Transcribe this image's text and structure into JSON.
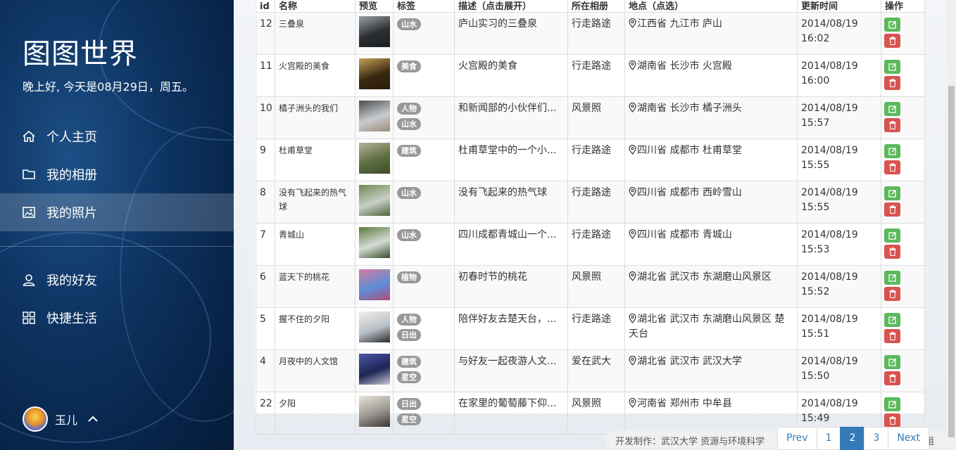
{
  "sidebar": {
    "brand": "图图世界",
    "greeting": "晚上好, 今天是08月29日，周五。",
    "nav": [
      {
        "label": "个人主页",
        "icon": "home-icon"
      },
      {
        "label": "我的相册",
        "icon": "folder-icon"
      },
      {
        "label": "我的照片",
        "icon": "image-icon",
        "active": true
      },
      {
        "label": "我的好友",
        "icon": "user-icon"
      },
      {
        "label": "快捷生活",
        "icon": "grid-icon"
      }
    ],
    "user": {
      "name": "玉儿",
      "icon": "chevron-up-icon"
    }
  },
  "table": {
    "headers": [
      "id",
      "名称",
      "预览",
      "标签",
      "描述（点击展开）",
      "所在相册",
      "地点（点选）",
      "更新时间",
      "操作"
    ],
    "rows": [
      {
        "id": "12",
        "name": "三叠泉",
        "tags": [
          "山水"
        ],
        "desc": "庐山实习的三叠泉",
        "album": "行走路途",
        "location": "江西省 九江市 庐山",
        "date": "2014/08/19",
        "time": "16:02",
        "thumb": [
          "#2b2f33",
          "#9aa0a4",
          "#1a1d20"
        ]
      },
      {
        "id": "11",
        "name": "火宫殿的美食",
        "tags": [
          "美食"
        ],
        "desc": "火宫殿的美食",
        "album": "行走路途",
        "location": "湖南省 长沙市 火宫殿",
        "date": "2014/08/19",
        "time": "16:00",
        "thumb": [
          "#3a2a12",
          "#c9a25a",
          "#2a1c0c"
        ]
      },
      {
        "id": "10",
        "name": "橘子洲头的我们",
        "tags": [
          "人物",
          "山水"
        ],
        "desc": "和新闻部的小伙伴们...",
        "album": "风景照",
        "location": "湖南省 长沙市 橘子洲头",
        "date": "2014/08/19",
        "time": "15:57",
        "thumb": [
          "#c8ccd0",
          "#4b4b4b",
          "#9a8b7c"
        ]
      },
      {
        "id": "9",
        "name": "杜甫草堂",
        "tags": [
          "建筑"
        ],
        "desc": "杜甫草堂中的一个小...",
        "album": "行走路途",
        "location": "四川省 成都市 杜甫草堂",
        "date": "2014/08/19",
        "time": "15:55",
        "thumb": [
          "#5c6e3f",
          "#b7b19a",
          "#3e4a2c"
        ]
      },
      {
        "id": "8",
        "name": "没有飞起来的热气球",
        "tags": [
          "山水"
        ],
        "desc": "没有飞起来的热气球",
        "album": "行走路途",
        "location": "四川省 成都市 西岭雪山",
        "date": "2014/08/19",
        "time": "15:55",
        "thumb": [
          "#c9cfc8",
          "#6e8a4e",
          "#4c6436"
        ]
      },
      {
        "id": "7",
        "name": "青城山",
        "tags": [
          "山水"
        ],
        "desc": "四川成都青城山一个...",
        "album": "行走路途",
        "location": "四川省 成都市 青城山",
        "date": "2014/08/19",
        "time": "15:53",
        "thumb": [
          "#d7dbd6",
          "#5a7a3a",
          "#34502a"
        ]
      },
      {
        "id": "6",
        "name": "蓝天下的桃花",
        "tags": [
          "植物"
        ],
        "desc": "初春时节的桃花",
        "album": "风景照",
        "location": "湖北省 武汉市 东湖磨山风景区",
        "date": "2014/08/19",
        "time": "15:52",
        "thumb": [
          "#5d8fd6",
          "#d47aa0",
          "#b04a78"
        ]
      },
      {
        "id": "5",
        "name": "握不住的夕阳",
        "tags": [
          "人物",
          "日出"
        ],
        "desc": "陪伴好友去楚天台，...",
        "album": "行走路途",
        "location": "湖北省 武汉市 东湖磨山风景区 楚天台",
        "date": "2014/08/19",
        "time": "15:51",
        "thumb": [
          "#b9c0c8",
          "#f2efe6",
          "#2b2b2b"
        ]
      },
      {
        "id": "4",
        "name": "月夜中的人文馆",
        "tags": [
          "建筑",
          "星空"
        ],
        "desc": "与好友一起夜游人文...",
        "album": "爱在武大",
        "location": "湖北省 武汉市 武汉大学",
        "date": "2014/08/19",
        "time": "15:50",
        "thumb": [
          "#1d2454",
          "#4a57a8",
          "#c8c8d8"
        ]
      },
      {
        "id": "22",
        "name": "夕阳",
        "tags": [
          "日出",
          "星空"
        ],
        "desc": "在家里的葡萄藤下仰...",
        "album": "风景照",
        "location": "河南省 郑州市 中牟县",
        "date": "2014/08/19",
        "time": "15:49",
        "thumb": [
          "#9a9590",
          "#e8e3d8",
          "#3a352e"
        ]
      }
    ]
  },
  "footer": {
    "text": "开发制作：武汉大学 资源与环境科学",
    "tail": "组"
  },
  "pagination": {
    "prev": "Prev",
    "pages": [
      "1",
      "2",
      "3"
    ],
    "active": "2",
    "next": "Next"
  },
  "colors": {
    "edit": "#5cb85c",
    "delete": "#d9534f",
    "tag": "#999999",
    "link": "#337ab7"
  }
}
